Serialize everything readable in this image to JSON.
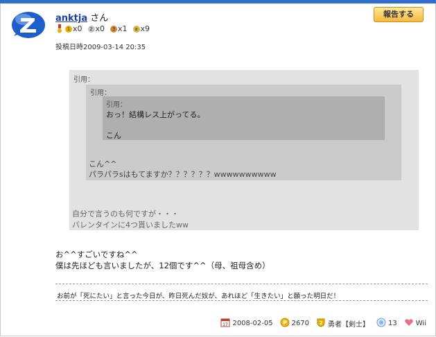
{
  "post": {
    "username": "anktja",
    "honorific": "さん",
    "report_label": "報告する",
    "timestamp": "投稿日時2009-03-14 20:35"
  },
  "medals": [
    {
      "icon": "gold-medal-icon",
      "count": "x0",
      "color": "#e8b200",
      "digit": "1"
    },
    {
      "icon": "silver-medal-icon",
      "count": "x0",
      "color": "#b8b8b8",
      "digit": "2"
    },
    {
      "icon": "bronze-medal-icon",
      "count": "x1",
      "color": "#d08a3a",
      "digit": "3"
    },
    {
      "icon": "special-medal-icon",
      "count": "x9",
      "color": "#d4b84a",
      "digit": "a"
    }
  ],
  "quotes": {
    "outer_label": "引用：",
    "outer_lines": [
      "自分で言うのも何ですが・・・",
      "バレンタインに4つ貰いましたww"
    ],
    "middle_label": "引用：",
    "middle_lines": [
      "こん^^",
      "パラパラsはもてますか？？？？？？wwwwwwwwww"
    ],
    "inner_label": "引用：",
    "inner_lines": [
      "おっ！結構レス上がってる。",
      "こん"
    ]
  },
  "message": {
    "line1": "お^^すごいですね^^",
    "line2": "僕は先ほども言いましたが、12個です^^（母、祖母含め）"
  },
  "signature": "お前が「死にたい」と言った今日が、昨日死んだ奴が、あれほど「生きたい」と願った明日だ！",
  "footer": {
    "join_date": "2008-02-05",
    "points": "2670",
    "rank": "勇者【剣士】",
    "level": "13",
    "platform": "Wii"
  },
  "colors": {
    "accent": "#2f6fd0",
    "link": "#1a3fa6",
    "report_bg": "#f5b93d"
  }
}
